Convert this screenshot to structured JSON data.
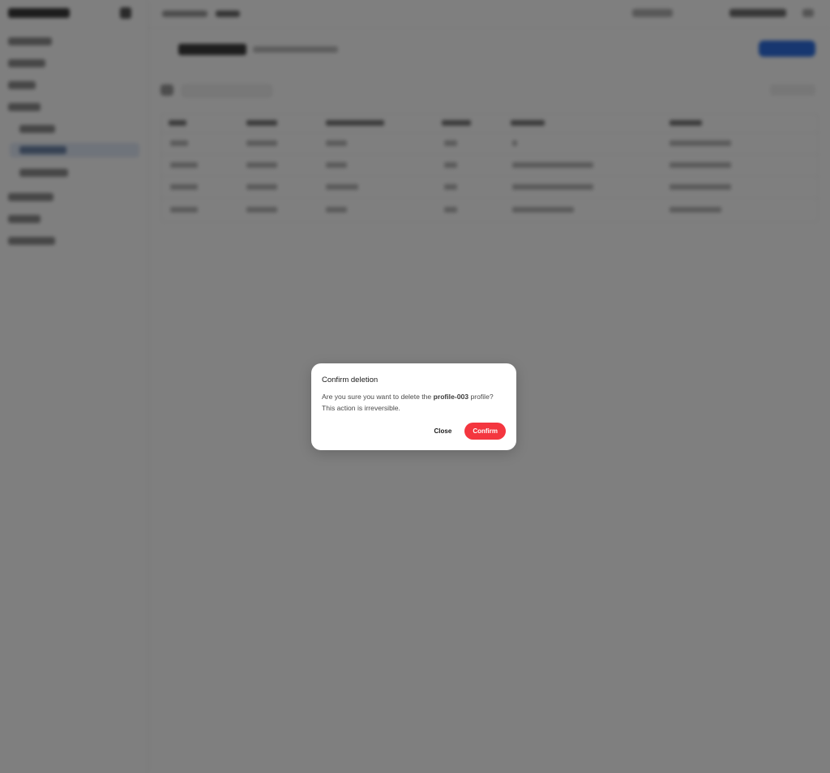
{
  "dialog": {
    "title": "Confirm deletion",
    "message_prefix": "Are you sure you want to delete the ",
    "profile_name": "profile-003",
    "message_suffix": " profile? This action is irreversible.",
    "close_label": "Close",
    "confirm_label": "Confirm"
  },
  "colors": {
    "overlay": "rgba(0,0,0,0.5)",
    "confirm_button": "#f4363f",
    "primary_accent": "#2e6fe0"
  }
}
